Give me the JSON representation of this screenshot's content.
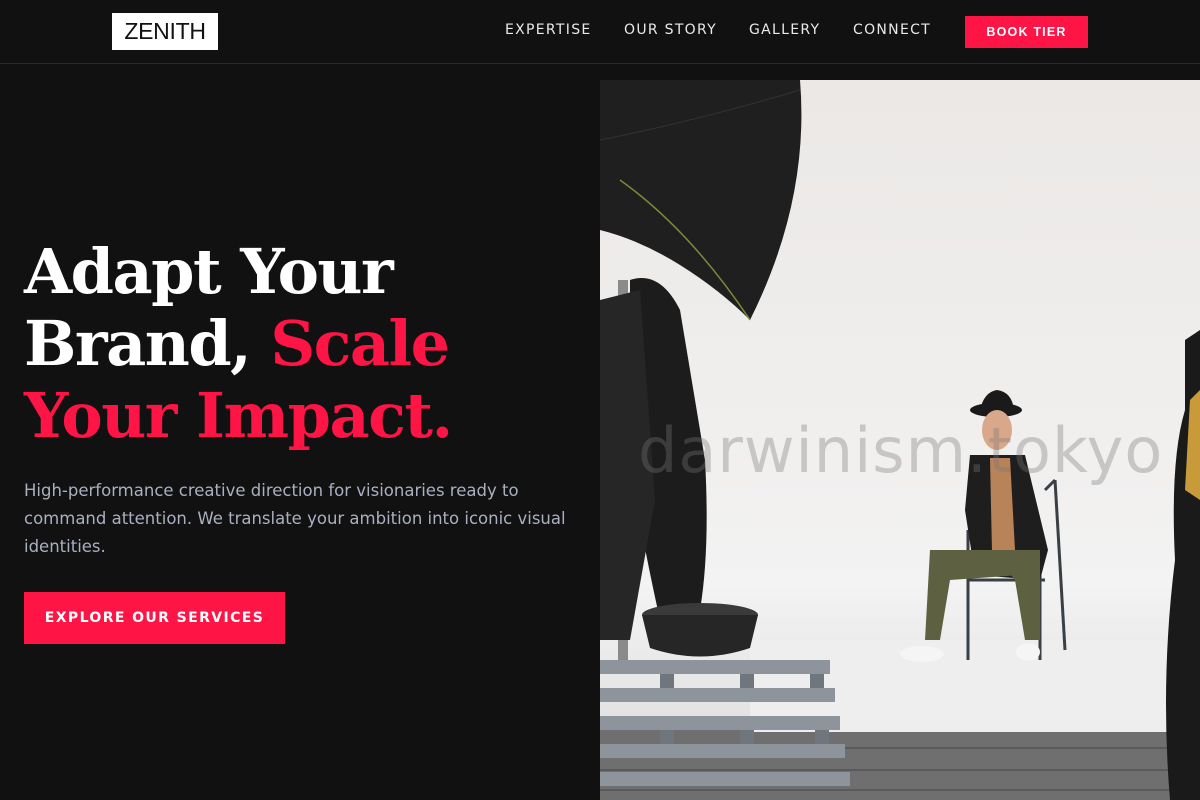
{
  "header": {
    "logo": "ZENITH",
    "nav": [
      "EXPERTISE",
      "OUR STORY",
      "GALLERY",
      "CONNECT"
    ],
    "cta_label": "BOOK TIER"
  },
  "hero": {
    "headline_line1": "Adapt Your",
    "headline_line2a": "Brand, ",
    "headline_line2b": "Scale",
    "headline_line3": "Your Impact.",
    "subtext": "High-performance creative direction for visionaries ready to command attention. We translate your ambition into iconic visual identities.",
    "cta_label": "EXPLORE OUR SERVICES",
    "image_watermark": "darwinism.tokyo"
  },
  "colors": {
    "background": "#111112",
    "accent": "#ff1446",
    "body_text": "#a9b0bf",
    "logo_bg": "#ffffff"
  },
  "icons": {
    "hero_image": "photo-studio-image"
  }
}
